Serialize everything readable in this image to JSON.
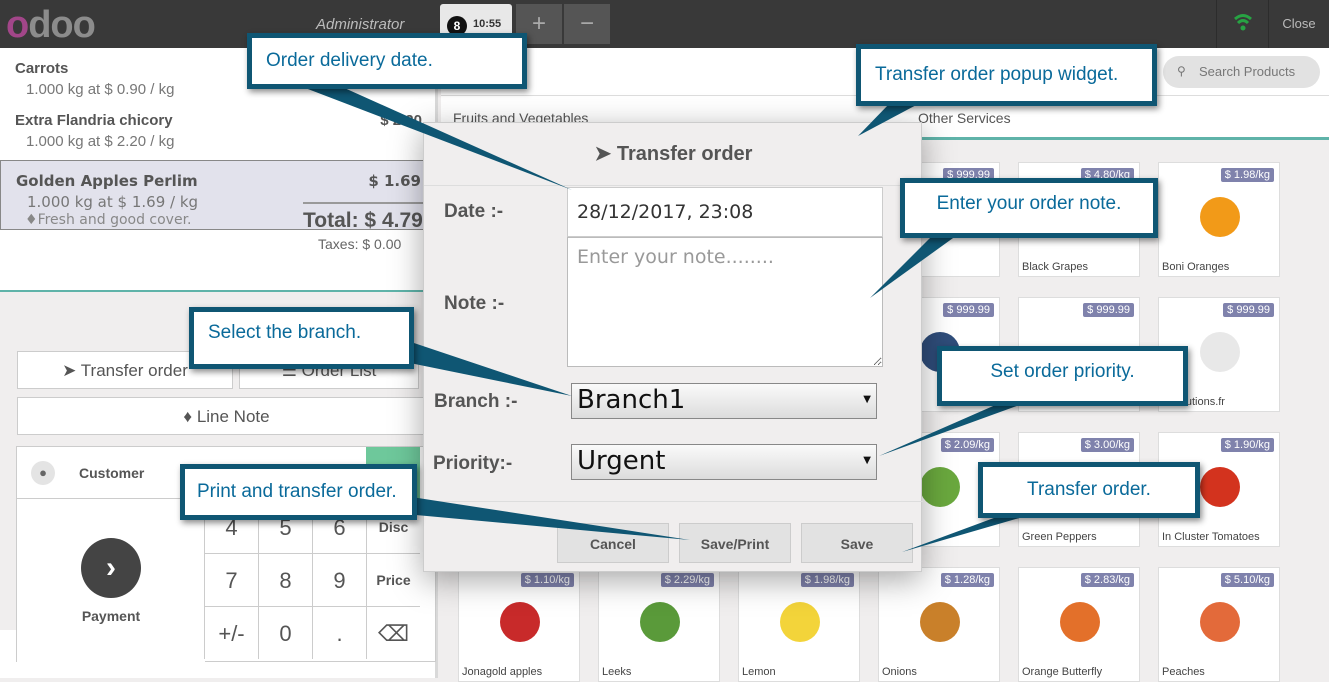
{
  "topbar": {
    "logo": "odoo",
    "user": "Administrator",
    "order_badge": "8",
    "order_time": "10:55",
    "add_label": "+",
    "remove_label": "−",
    "close_label": "Close"
  },
  "orderlines": [
    {
      "name": "Carrots",
      "detail": "1.000 kg at $ 0.90 / kg",
      "price": ""
    },
    {
      "name": "Extra Flandria chicory",
      "detail": "1.000 kg at $ 2.20 / kg",
      "price": "$ 2.20"
    },
    {
      "name": "Golden Apples Perlim",
      "detail": "1.000 kg at $ 1.69 / kg",
      "price": "$ 1.69",
      "note": "Fresh and good cover."
    }
  ],
  "totals": {
    "total": "Total: $ 4.79",
    "taxes": "Taxes: $ 0.00"
  },
  "actions": {
    "transfer_order": "Transfer order",
    "order_list": "Order List",
    "line_note": "Line Note"
  },
  "pad": {
    "customer": "Customer",
    "payment": "Payment",
    "keys": [
      "4",
      "5",
      "6",
      "Disc",
      "7",
      "8",
      "9",
      "Price",
      "+/-",
      "0",
      ".",
      "⌫"
    ]
  },
  "products": {
    "search_placeholder": "Search Products",
    "categories": [
      "Fruits and Vegetables",
      "Other Services"
    ],
    "cards": [
      {
        "name": "",
        "price": "$ 999.99"
      },
      {
        "name": "Black Grapes",
        "price": "$ 4.80/kg"
      },
      {
        "name": "Boni Oranges",
        "price": "$ 1.98/kg"
      },
      {
        "name": "",
        "price": "$ 999.99"
      },
      {
        "name": "",
        "price": "$ 999.99"
      },
      {
        "name": "e-solutions.fr",
        "price": "$ 999.99"
      },
      {
        "name": "",
        "price": "$ 2.09/kg"
      },
      {
        "name": "Green Peppers",
        "price": "$ 3.00/kg"
      },
      {
        "name": "In Cluster Tomatoes",
        "price": "$ 1.90/kg"
      },
      {
        "name": "Jonagold apples",
        "price": "$ 1.10/kg"
      },
      {
        "name": "Leeks",
        "price": "$ 2.29/kg"
      },
      {
        "name": "Lemon",
        "price": "$ 1.98/kg"
      },
      {
        "name": "Onions",
        "price": "$ 1.28/kg"
      },
      {
        "name": "Orange Butterfly",
        "price": "$ 2.83/kg"
      },
      {
        "name": "Peaches",
        "price": "$ 5.10/kg"
      }
    ]
  },
  "modal": {
    "title": "Transfer order",
    "date_label": "Date :-",
    "date_value": "28/12/2017, 23:08",
    "note_label": "Note :-",
    "note_placeholder": "Enter your note........",
    "branch_label": "Branch :-",
    "branch_value": "Branch1",
    "priority_label": "Priority:-",
    "priority_value": "Urgent",
    "cancel": "Cancel",
    "save_print": "Save/Print",
    "save": "Save"
  },
  "callouts": {
    "delivery_date": "Order delivery date.",
    "popup_widget": "Transfer order popup widget.",
    "order_note": "Enter your order note.",
    "branch": "Select the branch.",
    "priority": "Set order priority.",
    "print_transfer": "Print and transfer order.",
    "transfer": "Transfer order."
  },
  "colors": {
    "callout_border": "#0f5673",
    "callout_text": "#0a6a9a",
    "accent": "#5fb3a9",
    "price_tag": "#7f82ac"
  }
}
